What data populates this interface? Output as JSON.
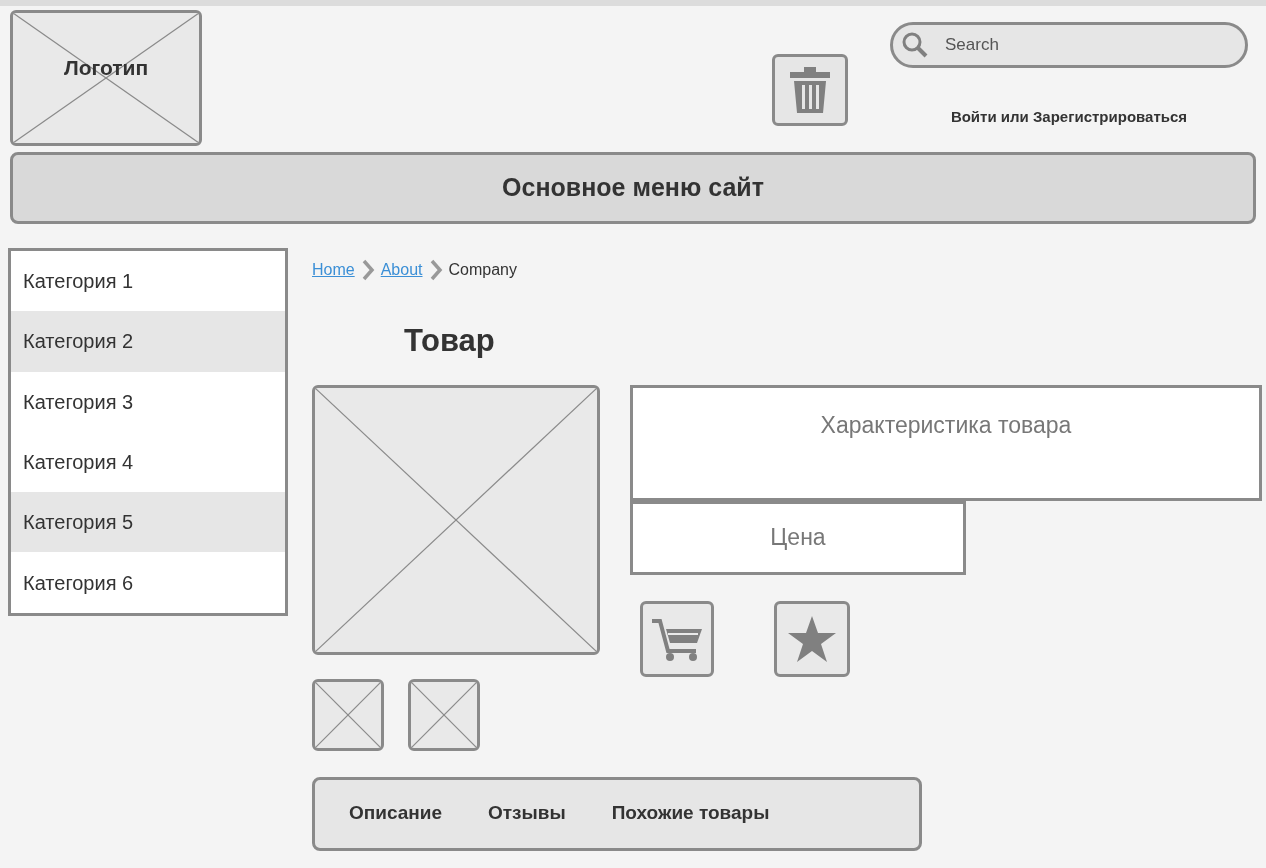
{
  "header": {
    "logo": "Логотип",
    "search": {
      "placeholder": "Search"
    },
    "login": "Войти или Зарегистрироваться"
  },
  "main_menu": "Основное меню сайт",
  "sidebar": {
    "items": [
      {
        "label": "Категория 1",
        "selected": false
      },
      {
        "label": "Категория 2",
        "selected": true
      },
      {
        "label": "Категория 3",
        "selected": false
      },
      {
        "label": "Категория 4",
        "selected": false
      },
      {
        "label": "Категория 5",
        "selected": true
      },
      {
        "label": "Категория 6",
        "selected": false
      }
    ]
  },
  "breadcrumb": [
    {
      "label": "Home",
      "kind": "link"
    },
    {
      "label": "About",
      "kind": "link"
    },
    {
      "label": "Company",
      "kind": "current"
    }
  ],
  "product": {
    "title": "Товар",
    "specs": "Характеристика товара",
    "price": "Цена"
  },
  "tabs": [
    {
      "label": "Описание"
    },
    {
      "label": "Отзывы"
    },
    {
      "label": "Похожие товары"
    }
  ]
}
